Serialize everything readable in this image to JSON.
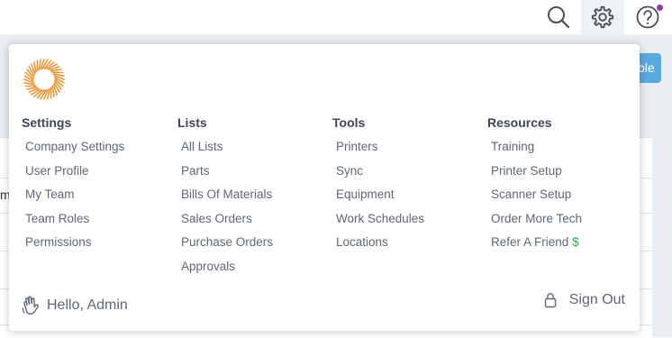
{
  "background": {
    "partial_label": "m",
    "partial_button_text": "ble"
  },
  "menu": {
    "columns": [
      {
        "title": "Settings",
        "items": [
          "Company Settings",
          "User Profile",
          "My Team",
          "Team Roles",
          "Permissions"
        ]
      },
      {
        "title": "Lists",
        "items": [
          "All Lists",
          "Parts",
          "Bills Of Materials",
          "Sales Orders",
          "Purchase Orders",
          "Approvals"
        ]
      },
      {
        "title": "Tools",
        "items": [
          "Printers",
          "Sync",
          "Equipment",
          "Work Schedules",
          "Locations"
        ]
      },
      {
        "title": "Resources",
        "items": [
          "Training",
          "Printer Setup",
          "Scanner Setup",
          "Order More Tech",
          "Refer A Friend"
        ]
      }
    ],
    "refer_symbol": "$",
    "greeting": "Hello, Admin",
    "sign_out": "Sign Out"
  },
  "icons": {
    "search": "search-icon",
    "settings": "gear-icon",
    "help": "help-icon",
    "hello": "waving-hand-icon",
    "sign_out": "lock-icon",
    "logo": "sunburst-logo"
  },
  "colors": {
    "logo": "#e6973a",
    "notification_dot": "#8e3ab0",
    "dollar": "#2eaa4f",
    "accent_button": "#5aa9df"
  }
}
